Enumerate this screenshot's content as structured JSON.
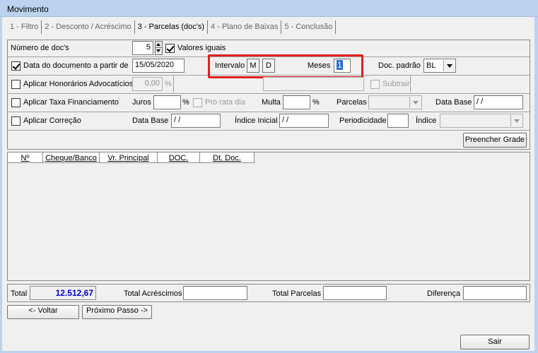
{
  "window": {
    "title": "Movimento"
  },
  "tabs": [
    {
      "label": "1 - Filtro"
    },
    {
      "label": "2 - Desconto / Acréscimo"
    },
    {
      "label": "3 - Parcelas (doc's)"
    },
    {
      "label": "4 - Plano de Baixas"
    },
    {
      "label": "5 - Conclusão"
    }
  ],
  "form": {
    "num_docs": {
      "label": "Número de doc's",
      "value": "5"
    },
    "valores_iguais": {
      "label": "Valores iguais",
      "checked": true
    },
    "data_doc": {
      "label": "Data do documento a partir de",
      "value": "15/05/2020",
      "checked": true
    },
    "intervalo": {
      "label": "Intervalo",
      "m": "M",
      "d": "D"
    },
    "meses": {
      "label": "Meses",
      "value": "1"
    },
    "doc_padrao": {
      "label": "Doc. padrão",
      "value": "BL"
    },
    "honorarios": {
      "label": "Aplicar Honorários Advocatícios",
      "value": "0,00",
      "unit": "%"
    },
    "subtrair": {
      "label": "Subtrair"
    },
    "taxa": {
      "label": "Aplicar Taxa Financiamento",
      "juros_label": "Juros",
      "juros_unit": "%",
      "pro_rata_label": "Pro rata dia",
      "multa_label": "Multa",
      "multa_unit": "%",
      "parcelas_label": "Parcelas",
      "data_base_label": "Data Base",
      "data_base_value": " / /"
    },
    "correcao": {
      "label": "Aplicar Correção",
      "data_base_label": "Data Base",
      "data_base_value": " / /",
      "indice_inicial_label": "Índice Inicial",
      "indice_inicial_value": " / /",
      "periodicidade_label": "Periodicidade",
      "indice_label": "Índice"
    },
    "preencher_label": "Preencher Grade"
  },
  "grid": {
    "columns": [
      "Nº",
      "Cheque/Banco",
      "Vr. Principal",
      "DOC.",
      "Dt. Doc."
    ]
  },
  "totals": {
    "total_label": "Total",
    "total_value": "12.512,67",
    "acrescimos_label": "Total Acréscimos",
    "parcelas_label": "Total Parcelas",
    "diferenca_label": "Diferença"
  },
  "buttons": {
    "voltar": "<- Voltar",
    "proximo": "Próximo Passo ->",
    "sair": "Sair"
  },
  "colors": {
    "highlight": "#e02020",
    "total_value": "#0000cc",
    "titlebar": "#bcd3ef"
  }
}
